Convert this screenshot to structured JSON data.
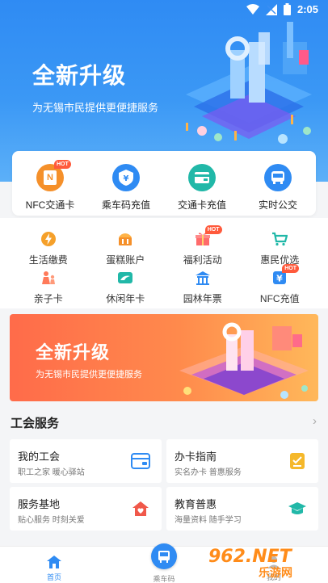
{
  "status": {
    "time": "2:05"
  },
  "hero": {
    "title": "全新升级",
    "subtitle": "为无锡市民提供更便捷服务"
  },
  "main_services": [
    {
      "label": "NFC交通卡",
      "icon": "nfc-card-icon",
      "glyph": "N",
      "color": "#f5902a",
      "hot": "HOT"
    },
    {
      "label": "乘车码充值",
      "icon": "yen-shield-icon",
      "glyph": "¥",
      "color": "#2f8bf3"
    },
    {
      "label": "交通卡充值",
      "icon": "card-icon",
      "glyph": "",
      "color": "#21b8a8"
    },
    {
      "label": "实时公交",
      "icon": "bus-icon",
      "glyph": "",
      "color": "#2f8bf3"
    }
  ],
  "grid": {
    "row1": [
      {
        "label": "生活缴费",
        "icon": "lightning-icon"
      },
      {
        "label": "蛋糕账户",
        "icon": "cake-icon"
      },
      {
        "label": "福利活动",
        "icon": "gift-icon",
        "hot": "HOT"
      },
      {
        "label": "惠民优选",
        "icon": "cart-icon"
      }
    ],
    "row2": [
      {
        "label": "亲子卡",
        "icon": "family-icon"
      },
      {
        "label": "休闲年卡",
        "icon": "leisure-card-icon"
      },
      {
        "label": "园林年票",
        "icon": "garden-icon"
      },
      {
        "label": "NFC充值",
        "icon": "nfc-recharge-icon",
        "hot": "HOT"
      }
    ]
  },
  "banner": {
    "title": "全新升级",
    "subtitle": "为无锡市民提供更便捷服务"
  },
  "union": {
    "title": "工会服务",
    "arrow": "›",
    "cards": [
      {
        "title": "我的工会",
        "subtitle": "职工之家  暖心驿站",
        "icon": "wallet-icon"
      },
      {
        "title": "办卡指南",
        "subtitle": "实名办卡  普惠服务",
        "icon": "guide-icon"
      },
      {
        "title": "服务基地",
        "subtitle": "贴心服务  时刻关爱",
        "icon": "home-heart-icon"
      },
      {
        "title": "教育普惠",
        "subtitle": "海量资料  随手学习",
        "icon": "graduation-cap-icon"
      }
    ]
  },
  "tabbar": {
    "tabs": [
      {
        "label": "首页",
        "icon": "home-icon",
        "active": true
      },
      {
        "label": "乘车码",
        "icon": "bus-code-icon"
      },
      {
        "label": "我的",
        "icon": "user-icon"
      }
    ]
  },
  "watermark": {
    "text": "962.NET",
    "sub": "乐游网"
  },
  "colors": {
    "primary": "#2f8bf3",
    "orange": "#f5902a",
    "teal": "#21b8a8",
    "red": "#ff5a3c"
  }
}
